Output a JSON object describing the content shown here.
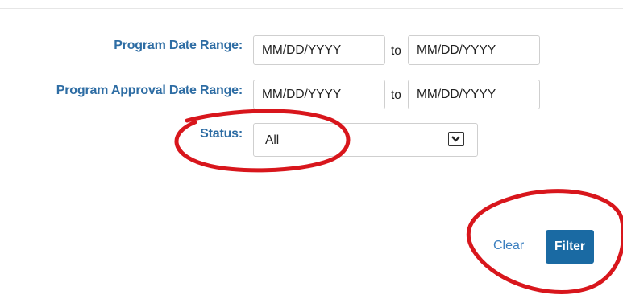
{
  "filters": {
    "program_date_range": {
      "label": "Program Date Range:",
      "from_placeholder": "MM/DD/YYYY",
      "separator": "to",
      "to_placeholder": "MM/DD/YYYY"
    },
    "program_approval_date_range": {
      "label": "Program Approval Date Range:",
      "from_placeholder": "MM/DD/YYYY",
      "separator": "to",
      "to_placeholder": "MM/DD/YYYY"
    },
    "status": {
      "label": "Status:",
      "selected": "All"
    }
  },
  "actions": {
    "clear_label": "Clear",
    "filter_label": "Filter"
  },
  "icons": {
    "status_dropdown": "chevron-down-icon"
  },
  "colors": {
    "label_text": "#2e6da4",
    "link": "#3b7fbf",
    "primary_button": "#1a6aa3",
    "annotation": "#d8161c"
  }
}
